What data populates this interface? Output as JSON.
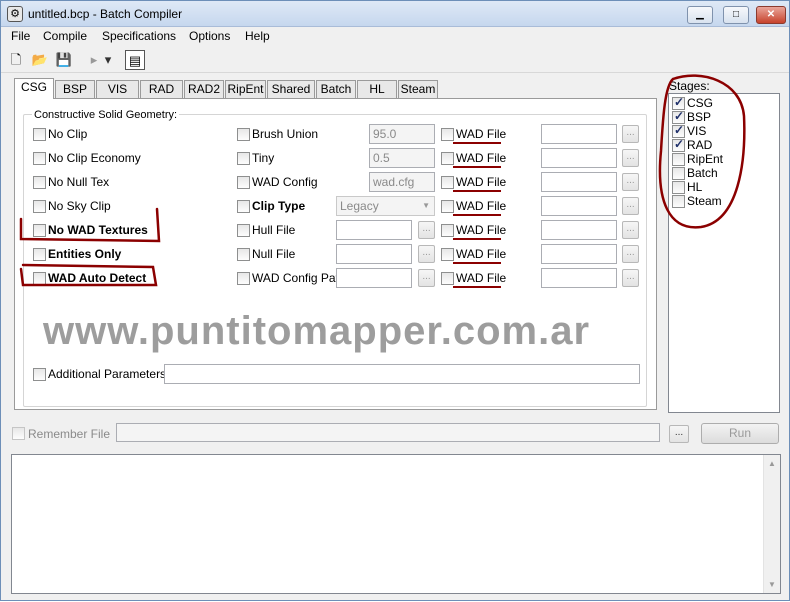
{
  "window": {
    "title": "untitled.bcp - Batch Compiler",
    "min": "▁",
    "max": "□",
    "close": "✕"
  },
  "menu": [
    "File",
    "Compile",
    "Specifications",
    "Options",
    "Help"
  ],
  "tabs": [
    "CSG",
    "BSP",
    "VIS",
    "RAD",
    "RAD2",
    "RipEnt",
    "Shared",
    "Batch",
    "HL",
    "Steam"
  ],
  "csg": {
    "group_title": "Constructive Solid Geometry:",
    "col1": [
      "No Clip",
      "No Clip Economy",
      "No Null Tex",
      "No Sky Clip",
      "No WAD Textures",
      "Entities Only",
      "WAD Auto Detect"
    ],
    "col2": [
      "Brush Union",
      "Tiny",
      "WAD Config",
      "Clip Type",
      "Hull File",
      "Null File",
      "WAD Config Path"
    ],
    "brush_union_value": "95.0",
    "tiny_value": "0.5",
    "wad_config_value": "wad.cfg",
    "clip_type_value": "Legacy",
    "wad_file_label": "WAD File",
    "browse": "...",
    "additional_parameters": "Additional Parameters"
  },
  "watermark": "www.puntitomapper.com.ar",
  "stages": {
    "label": "Stages:",
    "items": [
      {
        "name": "CSG",
        "checked": true
      },
      {
        "name": "BSP",
        "checked": true
      },
      {
        "name": "VIS",
        "checked": true
      },
      {
        "name": "RAD",
        "checked": true
      },
      {
        "name": "RipEnt",
        "checked": false
      },
      {
        "name": "Batch",
        "checked": false
      },
      {
        "name": "HL",
        "checked": false
      },
      {
        "name": "Steam",
        "checked": false
      }
    ]
  },
  "bottom": {
    "remember_file": "Remember File",
    "browse": "...",
    "run": "Run"
  },
  "toolbar": {
    "new_icon": "🗋",
    "open_icon": "📂",
    "save_icon": "💾",
    "run_icon": "▸",
    "dropdown_icon": "▾",
    "props_icon": "▤"
  },
  "annotation_color": "#8b0000"
}
